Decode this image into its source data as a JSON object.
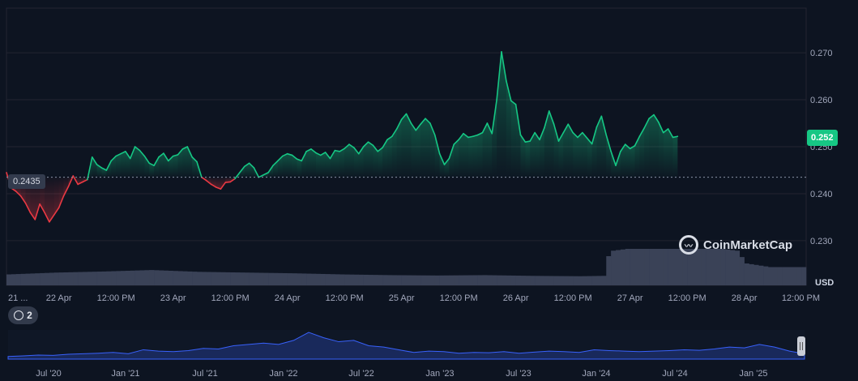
{
  "chart_data": {
    "type": "line",
    "currency_label": "USD",
    "current_price_label": "0.252",
    "reference_price_label": "0.2435",
    "reference_price": 0.2435,
    "ylim": [
      0.2205,
      0.2795
    ],
    "y_ticks": [
      "0.270",
      "0.260",
      "0.250",
      "0.240",
      "0.230"
    ],
    "y_tick_values": [
      0.27,
      0.26,
      0.25,
      0.24,
      0.23
    ],
    "x_ticks": [
      "21 ...",
      "22 Apr",
      "12:00 PM",
      "23 Apr",
      "12:00 PM",
      "24 Apr",
      "12:00 PM",
      "25 Apr",
      "12:00 PM",
      "26 Apr",
      "12:00 PM",
      "27 Apr",
      "12:00 PM",
      "28 Apr",
      "12:00 PM"
    ],
    "x_tick_hours": [
      0,
      11,
      23,
      35,
      47,
      59,
      71,
      83,
      95,
      107,
      119,
      131,
      143,
      155,
      167
    ],
    "price_series": {
      "hours": [
        0,
        1,
        2,
        3,
        4,
        5,
        6,
        7,
        8,
        9,
        10,
        11,
        12,
        13,
        14,
        15,
        16,
        17,
        18,
        19,
        20,
        21,
        22,
        23,
        24,
        25,
        26,
        27,
        28,
        29,
        30,
        31,
        32,
        33,
        34,
        35,
        36,
        37,
        38,
        39,
        40,
        41,
        42,
        43,
        44,
        45,
        46,
        47,
        48,
        49,
        50,
        51,
        52,
        53,
        54,
        55,
        56,
        57,
        58,
        59,
        60,
        61,
        62,
        63,
        64,
        65,
        66,
        67,
        68,
        69,
        70,
        71,
        72,
        73,
        74,
        75,
        76,
        77,
        78,
        79,
        80,
        81,
        82,
        83,
        84,
        85,
        86,
        87,
        88,
        89,
        90,
        91,
        92,
        93,
        94,
        95,
        96,
        97,
        98,
        99,
        100,
        101,
        102,
        103,
        104,
        105,
        106,
        107,
        108,
        109,
        110,
        111,
        112,
        113,
        114,
        115,
        116,
        117,
        118,
        119,
        120,
        121,
        122,
        123,
        124,
        125,
        126,
        127,
        128,
        129,
        130,
        131,
        132,
        133,
        134,
        135,
        136,
        137,
        138,
        139,
        140,
        141,
        142,
        143,
        144,
        145,
        146,
        147,
        148,
        149,
        150,
        151,
        152,
        153,
        154,
        155,
        156,
        157,
        158,
        159,
        160,
        161,
        162,
        163,
        164,
        165,
        166,
        167,
        168
      ],
      "values": [
        0.2445,
        0.2412,
        0.2405,
        0.2395,
        0.238,
        0.236,
        0.2345,
        0.2378,
        0.236,
        0.234,
        0.2355,
        0.237,
        0.2395,
        0.2415,
        0.2438,
        0.242,
        0.2425,
        0.243,
        0.2478,
        0.2462,
        0.2455,
        0.245,
        0.247,
        0.248,
        0.2485,
        0.249,
        0.2475,
        0.25,
        0.2492,
        0.248,
        0.2465,
        0.246,
        0.2478,
        0.2486,
        0.247,
        0.248,
        0.2483,
        0.2495,
        0.25,
        0.2478,
        0.2468,
        0.2435,
        0.2428,
        0.242,
        0.2414,
        0.241,
        0.2424,
        0.2425,
        0.2432,
        0.2445,
        0.2458,
        0.2465,
        0.2455,
        0.2435,
        0.244,
        0.2445,
        0.246,
        0.247,
        0.248,
        0.2485,
        0.2482,
        0.2474,
        0.247,
        0.249,
        0.2495,
        0.2487,
        0.2482,
        0.2488,
        0.2475,
        0.2492,
        0.249,
        0.2496,
        0.2505,
        0.2498,
        0.2485,
        0.25,
        0.251,
        0.2503,
        0.249,
        0.2498,
        0.2515,
        0.2522,
        0.2538,
        0.2558,
        0.257,
        0.255,
        0.2535,
        0.2548,
        0.256,
        0.255,
        0.2525,
        0.2485,
        0.2462,
        0.2475,
        0.2505,
        0.2515,
        0.2528,
        0.252,
        0.2522,
        0.2525,
        0.253,
        0.255,
        0.2528,
        0.26,
        0.2702,
        0.264,
        0.2598,
        0.259,
        0.2525,
        0.251,
        0.2512,
        0.253,
        0.2515,
        0.254,
        0.2576,
        0.2548,
        0.2512,
        0.253,
        0.2548,
        0.253,
        0.252,
        0.253,
        0.2518,
        0.2506,
        0.2542,
        0.2565,
        0.2525,
        0.249,
        0.246,
        0.249,
        0.2505,
        0.2496,
        0.2502,
        0.2522,
        0.254,
        0.256,
        0.2568,
        0.2552,
        0.253,
        0.2538,
        0.252,
        0.2522
      ]
    },
    "volume_series": {
      "hours": [
        0,
        10,
        20,
        30,
        40,
        50,
        60,
        70,
        80,
        90,
        100,
        110,
        120,
        125,
        126,
        127,
        130,
        140,
        150,
        153,
        155,
        160,
        168
      ],
      "values": [
        0.3,
        0.35,
        0.38,
        0.42,
        0.37,
        0.35,
        0.33,
        0.3,
        0.28,
        0.27,
        0.28,
        0.26,
        0.25,
        0.26,
        0.8,
        0.95,
        1.0,
        1.0,
        1.0,
        0.95,
        0.6,
        0.5,
        0.5
      ]
    },
    "navigator": {
      "x_ticks": [
        "Jul '20",
        "Jan '21",
        "Jul '21",
        "Jan '22",
        "Jul '22",
        "Jan '23",
        "Jul '23",
        "Jan '24",
        "Jul '24",
        "Jan '25"
      ],
      "series": [
        0.1,
        0.12,
        0.15,
        0.14,
        0.18,
        0.2,
        0.22,
        0.25,
        0.2,
        0.35,
        0.3,
        0.28,
        0.32,
        0.4,
        0.38,
        0.5,
        0.55,
        0.6,
        0.55,
        0.7,
        1.0,
        0.8,
        0.65,
        0.7,
        0.5,
        0.45,
        0.35,
        0.25,
        0.3,
        0.28,
        0.22,
        0.25,
        0.24,
        0.28,
        0.22,
        0.26,
        0.3,
        0.28,
        0.25,
        0.35,
        0.32,
        0.3,
        0.28,
        0.3,
        0.32,
        0.35,
        0.33,
        0.38,
        0.45,
        0.42,
        0.55,
        0.45,
        0.3,
        0.2
      ]
    }
  },
  "ui": {
    "history_count": "2",
    "logo_text": "CoinMarketCap",
    "logo_icon": "coinmarketcap-logo-icon",
    "history_icon": "history-icon",
    "colors": {
      "up": "#16c784",
      "down": "#ea3943",
      "volume": "#3a4257",
      "navigator": "#3861fb",
      "grid": "#222531",
      "background": "#0d1421"
    }
  }
}
